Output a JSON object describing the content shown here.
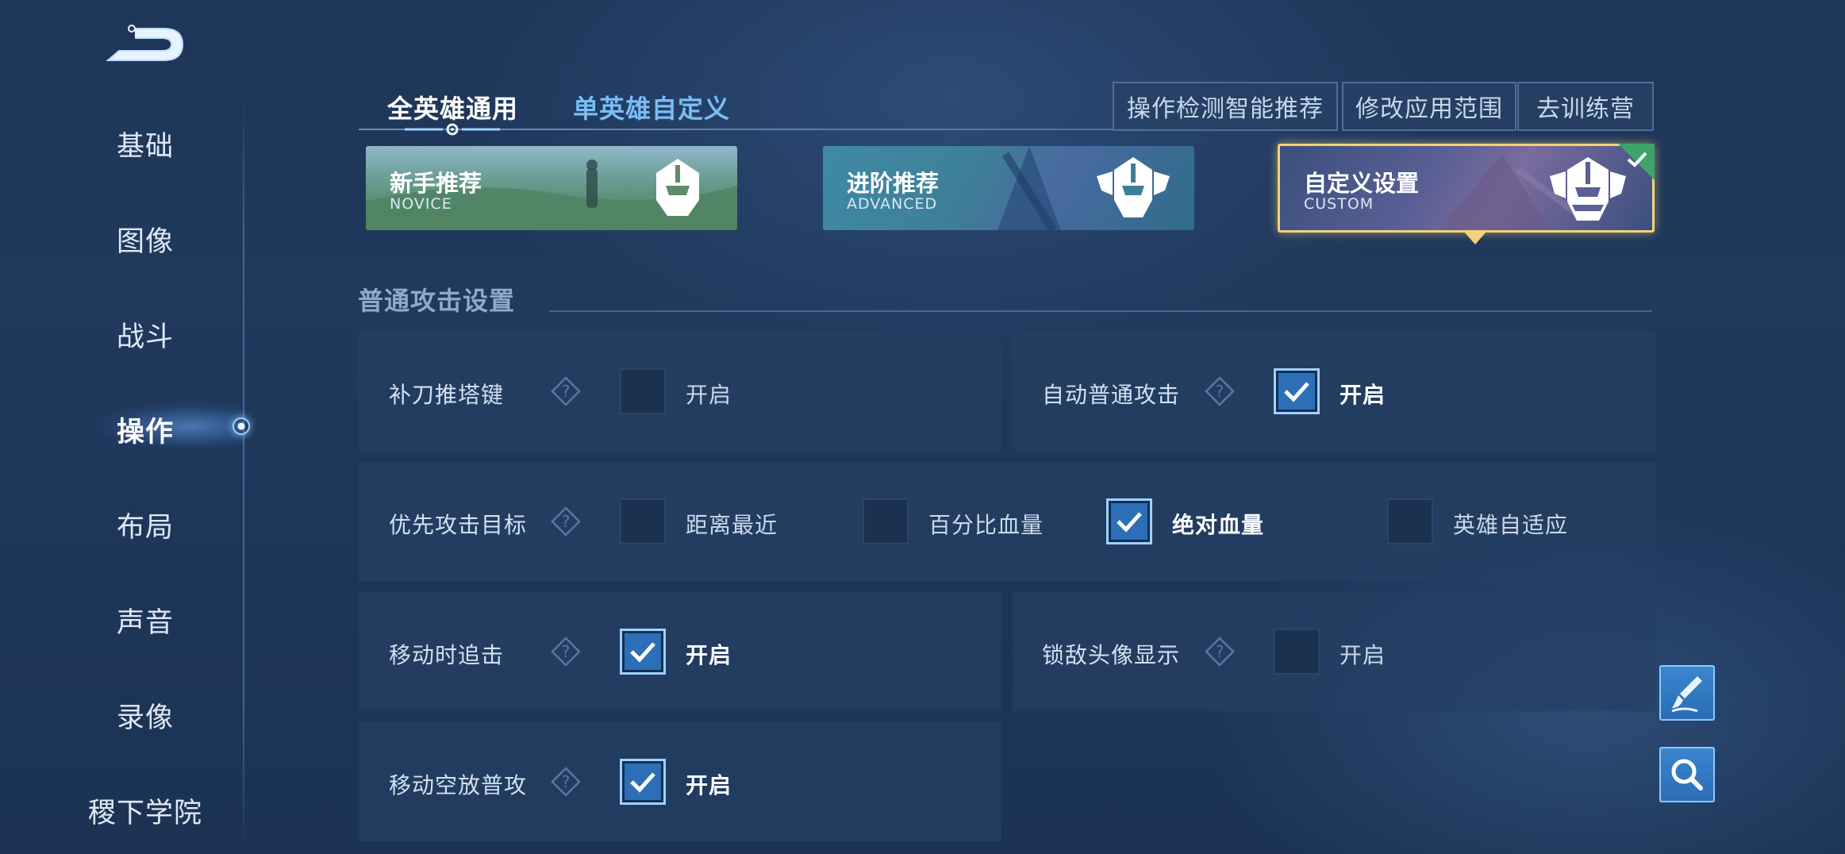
{
  "sidebar": {
    "items": [
      {
        "label": "基础"
      },
      {
        "label": "图像"
      },
      {
        "label": "战斗"
      },
      {
        "label": "操作",
        "active": true
      },
      {
        "label": "布局"
      },
      {
        "label": "声音"
      },
      {
        "label": "录像"
      },
      {
        "label": "稷下学院"
      }
    ]
  },
  "tabs": [
    {
      "label": "全英雄通用",
      "active": true
    },
    {
      "label": "单英雄自定义",
      "active": false
    }
  ],
  "toolbar": {
    "smart_recommend": "操作检测智能推荐",
    "modify_scope": "修改应用范围",
    "training_camp": "去训练营"
  },
  "presets": [
    {
      "title": "新手推荐",
      "subtitle": "NOVICE",
      "selected": false
    },
    {
      "title": "进阶推荐",
      "subtitle": "ADVANCED",
      "selected": false
    },
    {
      "title": "自定义设置",
      "subtitle": "CUSTOM",
      "selected": true
    }
  ],
  "section": {
    "title": "普通攻击设置"
  },
  "settings": {
    "last_hit": {
      "label": "补刀推塔键",
      "option": "开启",
      "checked": false
    },
    "auto_attack": {
      "label": "自动普通攻击",
      "option": "开启",
      "checked": true
    },
    "priority_target": {
      "label": "优先攻击目标",
      "options": [
        {
          "label": "距离最近",
          "checked": false
        },
        {
          "label": "百分比血量",
          "checked": false
        },
        {
          "label": "绝对血量",
          "checked": true
        },
        {
          "label": "英雄自适应",
          "checked": false
        }
      ]
    },
    "chase_on_move": {
      "label": "移动时追击",
      "option": "开启",
      "checked": true
    },
    "lock_portrait": {
      "label": "锁敌头像显示",
      "option": "开启",
      "checked": false
    },
    "move_release_attack": {
      "label": "移动空放普攻",
      "option": "开启",
      "checked": true
    }
  },
  "icons": {
    "back": "back-arrow-icon",
    "help": "question-diamond-icon",
    "brush": "brush-icon",
    "search": "search-icon",
    "helmet": "helmet-icon",
    "check": "check-icon"
  },
  "colors": {
    "accent_blue": "#79bdf5",
    "selected_gold": "#f3d27a",
    "checkbox_on": "#2c6fb6"
  }
}
